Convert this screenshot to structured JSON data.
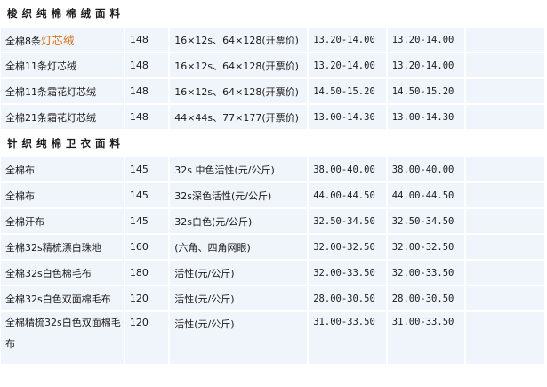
{
  "colors": {
    "cell_bg": "#f0f5fb",
    "grid": "#ffffff",
    "accent_text": "#d2731e"
  },
  "sections": [
    {
      "title": "梭织纯棉棉绒面料",
      "rows": [
        {
          "name_prefix": "全棉8条",
          "name_accent": "灯芯绒",
          "width": "148",
          "spec": "16×12s、64×128(开票价)",
          "price1": "13.20-14.00",
          "price2": "13.20-14.00"
        },
        {
          "name": "全棉11条灯芯绒",
          "width": "148",
          "spec": "16×12s、64×128(开票价)",
          "price1": "13.20-14.00",
          "price2": "13.20-14.00"
        },
        {
          "name": "全棉11条霜花灯芯绒",
          "width": "148",
          "spec": "16×12s、64×128(开票价)",
          "price1": "14.50-15.20",
          "price2": "14.50-15.20"
        },
        {
          "name": "全棉21条霜花灯芯绒",
          "width": "148",
          "spec": "44×44s、77×177(开票价)",
          "price1": "13.00-14.30",
          "price2": "13.00-14.30"
        }
      ]
    },
    {
      "title": "针织纯棉卫衣面料",
      "rows": [
        {
          "name": "全棉布",
          "width": "145",
          "spec": "32s 中色活性(元/公斤)",
          "price1": "38.00-40.00",
          "price2": "38.00-40.00"
        },
        {
          "name": "全棉布",
          "width": "145",
          "spec": "32s深色活性(元/公斤)",
          "price1": "44.00-44.50",
          "price2": "44.00-44.50"
        },
        {
          "name": "全棉汗布",
          "width": "145",
          "spec": "32s白色(元/公斤)",
          "price1": "32.50-34.50",
          "price2": "32.50-34.50"
        },
        {
          "name": "全棉32s精梳漂白珠地",
          "width": "160",
          "spec": "(六角、四角网眼)",
          "price1": "32.00-32.50",
          "price2": "32.00-32.50"
        },
        {
          "name": "全棉32s白色棉毛布",
          "width": "180",
          "spec": "活性(元/公斤)",
          "price1": "32.00-33.50",
          "price2": "32.00-33.50"
        },
        {
          "name": "全棉32s白色双面棉毛布",
          "width": "120",
          "spec": "活性(元/公斤)",
          "price1": "28.00-30.50",
          "price2": "28.00-30.50"
        },
        {
          "name": "全棉精梳32s白色双面棉毛布",
          "width": "120",
          "spec": "活性(元/公斤)",
          "price1": "31.00-33.50",
          "price2": "31.00-33.50"
        }
      ]
    }
  ]
}
